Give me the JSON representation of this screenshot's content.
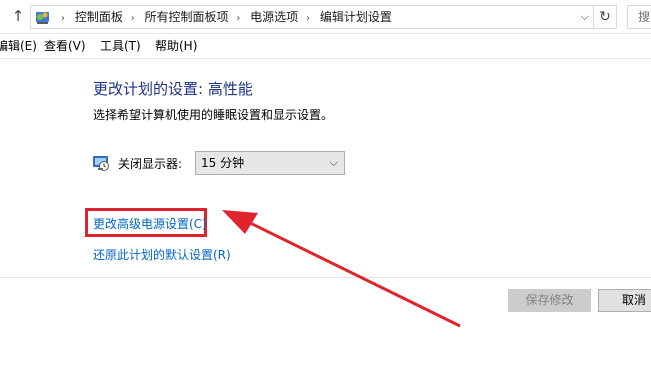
{
  "address_bar": {
    "breadcrumbs": [
      "控制面板",
      "所有控制面板项",
      "电源选项",
      "编辑计划设置"
    ],
    "search_placeholder": "搜"
  },
  "menu": [
    "编辑(E)",
    "查看(V)",
    "工具(T)",
    "帮助(H)"
  ],
  "content": {
    "title": "更改计划的设置: 高性能",
    "subtitle": "选择希望计算机使用的睡眠设置和显示设置。",
    "display_off_label": "关闭显示器:",
    "display_off_value": "15 分钟",
    "link_advanced": "更改高级电源设置(C)",
    "link_restore": "还原此计划的默认设置(R)"
  },
  "buttons": {
    "save": "保存修改",
    "cancel": "取消"
  },
  "colors": {
    "title": "#1e3287",
    "link": "#0066cc",
    "annotation": "#e0242e"
  },
  "icons": [
    "up-arrow-icon",
    "control-panel-icon",
    "chevron-down-icon",
    "refresh-icon",
    "display-icon"
  ]
}
